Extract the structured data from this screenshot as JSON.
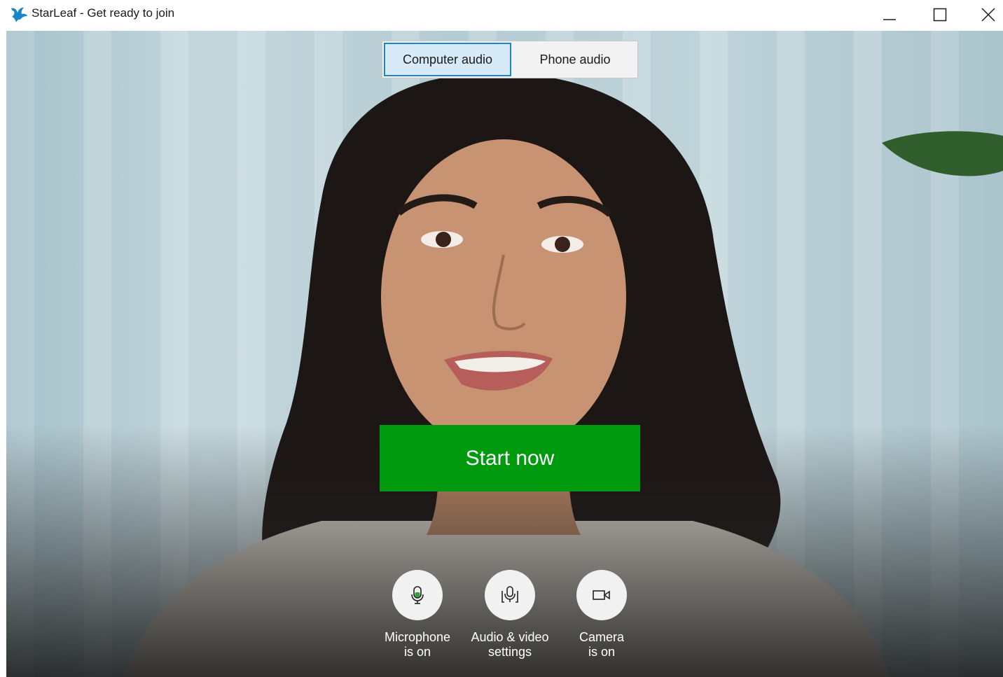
{
  "window": {
    "title": "StarLeaf - Get ready to join",
    "logo_icon": "starleaf-logo-icon",
    "brand_color": "#1a86c6"
  },
  "audio_toggle": {
    "options": [
      {
        "label": "Computer audio",
        "selected": true
      },
      {
        "label": "Phone audio",
        "selected": false
      }
    ]
  },
  "start_button": {
    "label": "Start now",
    "color": "#009a0e"
  },
  "controls": [
    {
      "icon": "microphone-icon",
      "line1": "Microphone",
      "line2": "is on"
    },
    {
      "icon": "audio-video-settings-icon",
      "line1": "Audio & video",
      "line2": "settings"
    },
    {
      "icon": "camera-icon",
      "line1": "Camera",
      "line2": "is on"
    }
  ]
}
